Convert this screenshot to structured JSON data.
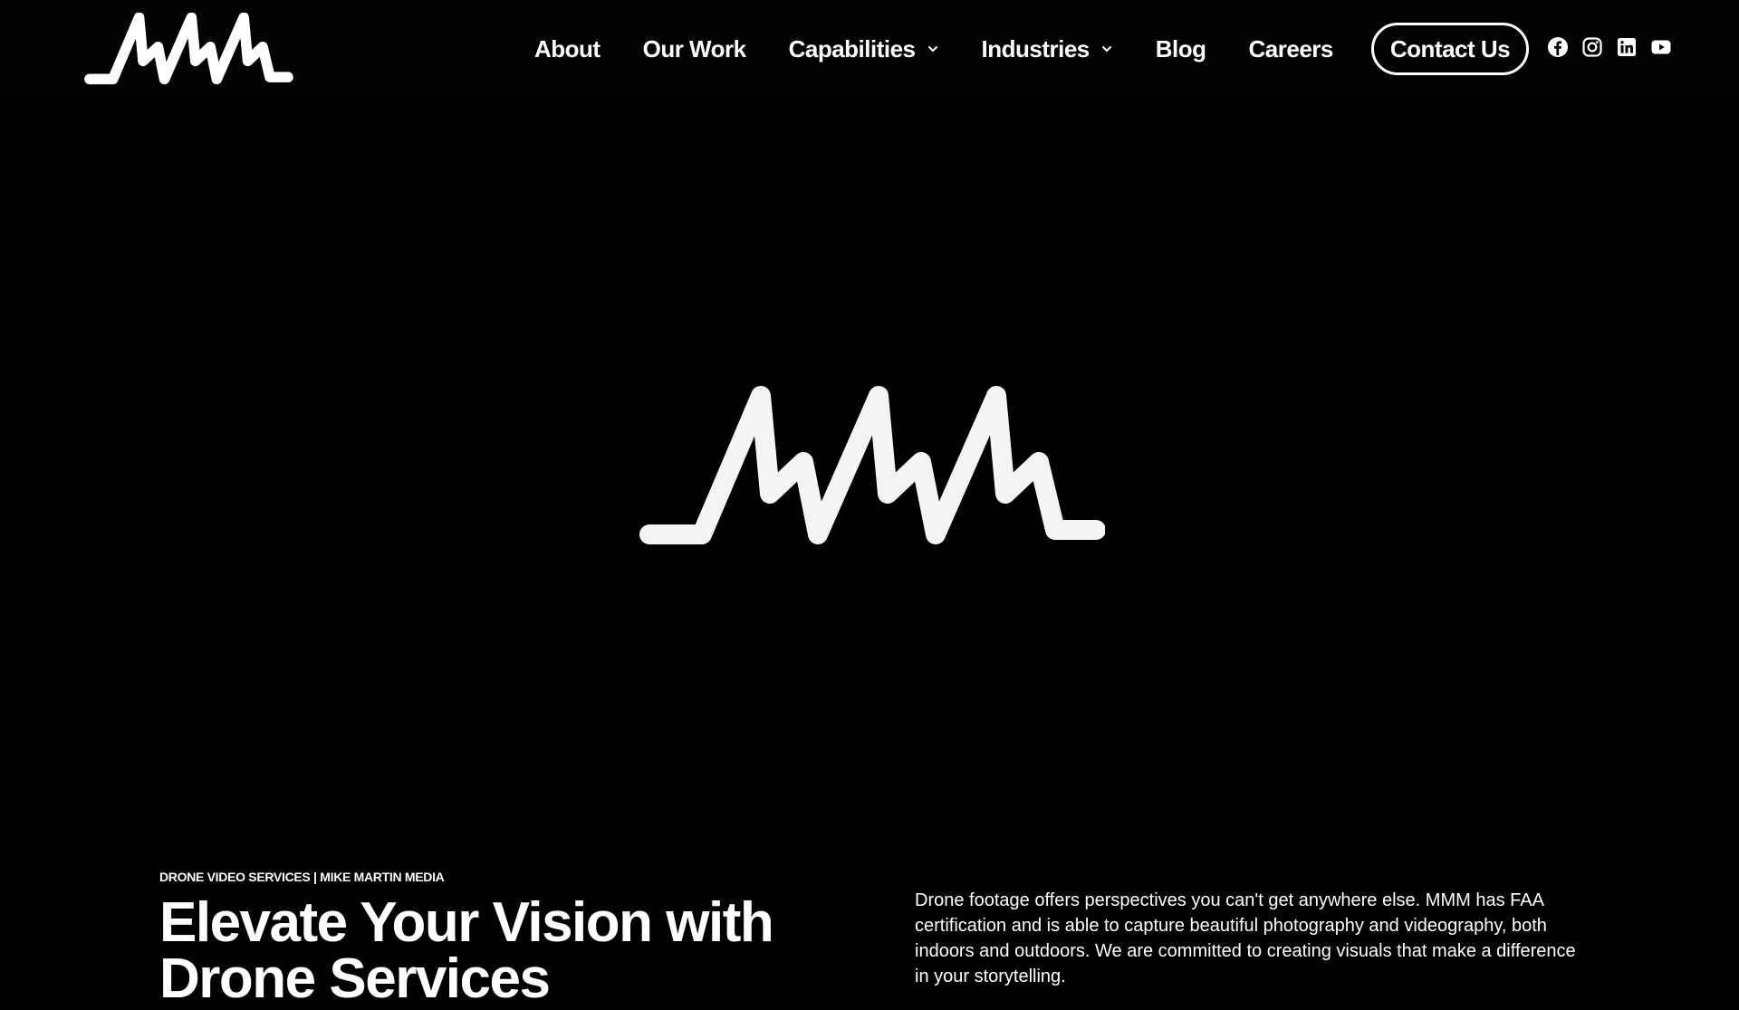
{
  "brand": {
    "logo_alt": "MMM",
    "accent": "#ffffff",
    "background": "#000000"
  },
  "nav": {
    "items": [
      {
        "label": "About",
        "has_dropdown": false
      },
      {
        "label": "Our Work",
        "has_dropdown": false
      },
      {
        "label": "Capabilities",
        "has_dropdown": true
      },
      {
        "label": "Industries",
        "has_dropdown": true
      },
      {
        "label": "Blog",
        "has_dropdown": false
      },
      {
        "label": "Careers",
        "has_dropdown": false
      }
    ],
    "cta_label": "Contact Us"
  },
  "social": [
    "facebook-icon",
    "instagram-icon",
    "linkedin-icon",
    "youtube-icon"
  ],
  "hero": {
    "logo_alt": "MMM"
  },
  "intro": {
    "eyebrow": "DRONE VIDEO SERVICES | MIKE MARTIN MEDIA",
    "headline": "Elevate Your Vision with Drone Services",
    "description": "Drone footage offers perspectives you can't get anywhere else. MMM has FAA certification and is able to capture beautiful photography and videography, both indoors and outdoors. We are committed to creating visuals that make a difference in your storytelling."
  }
}
